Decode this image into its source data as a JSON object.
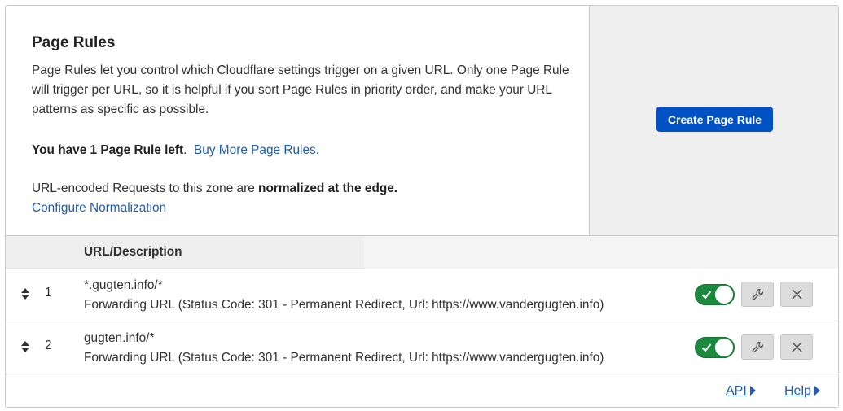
{
  "header": {
    "title": "Page Rules",
    "description": "Page Rules let you control which Cloudflare settings trigger on a given URL. Only one Page Rule will trigger per URL, so it is helpful if you sort Page Rules in priority order, and make your URL patterns as specific as possible.",
    "limit_bold": "You have 1 Page Rule left",
    "limit_suffix": ".",
    "buy_more_link": "Buy More Page Rules.",
    "normalization_prefix": "URL-encoded Requests to this zone are ",
    "normalization_bold": "normalized at the edge.",
    "configure_link": "Configure Normalization",
    "create_button": "Create Page Rule"
  },
  "table": {
    "column_header": "URL/Description",
    "rows": [
      {
        "priority": "1",
        "url": "*.gugten.info/*",
        "description": "Forwarding URL (Status Code: 301 - Permanent Redirect, Url: https://www.vandergugten.info)",
        "enabled": true
      },
      {
        "priority": "2",
        "url": "gugten.info/*",
        "description": "Forwarding URL (Status Code: 301 - Permanent Redirect, Url: https://www.vandergugten.info)",
        "enabled": true
      }
    ]
  },
  "footer": {
    "api_link": "API",
    "help_link": "Help"
  },
  "colors": {
    "primary_button": "#0051c3",
    "link": "#1f5bb5",
    "toggle_on": "#1b8a3e"
  },
  "icons": [
    "sort-arrows-icon",
    "check-icon",
    "wrench-icon",
    "close-icon",
    "triangle-right-icon"
  ]
}
